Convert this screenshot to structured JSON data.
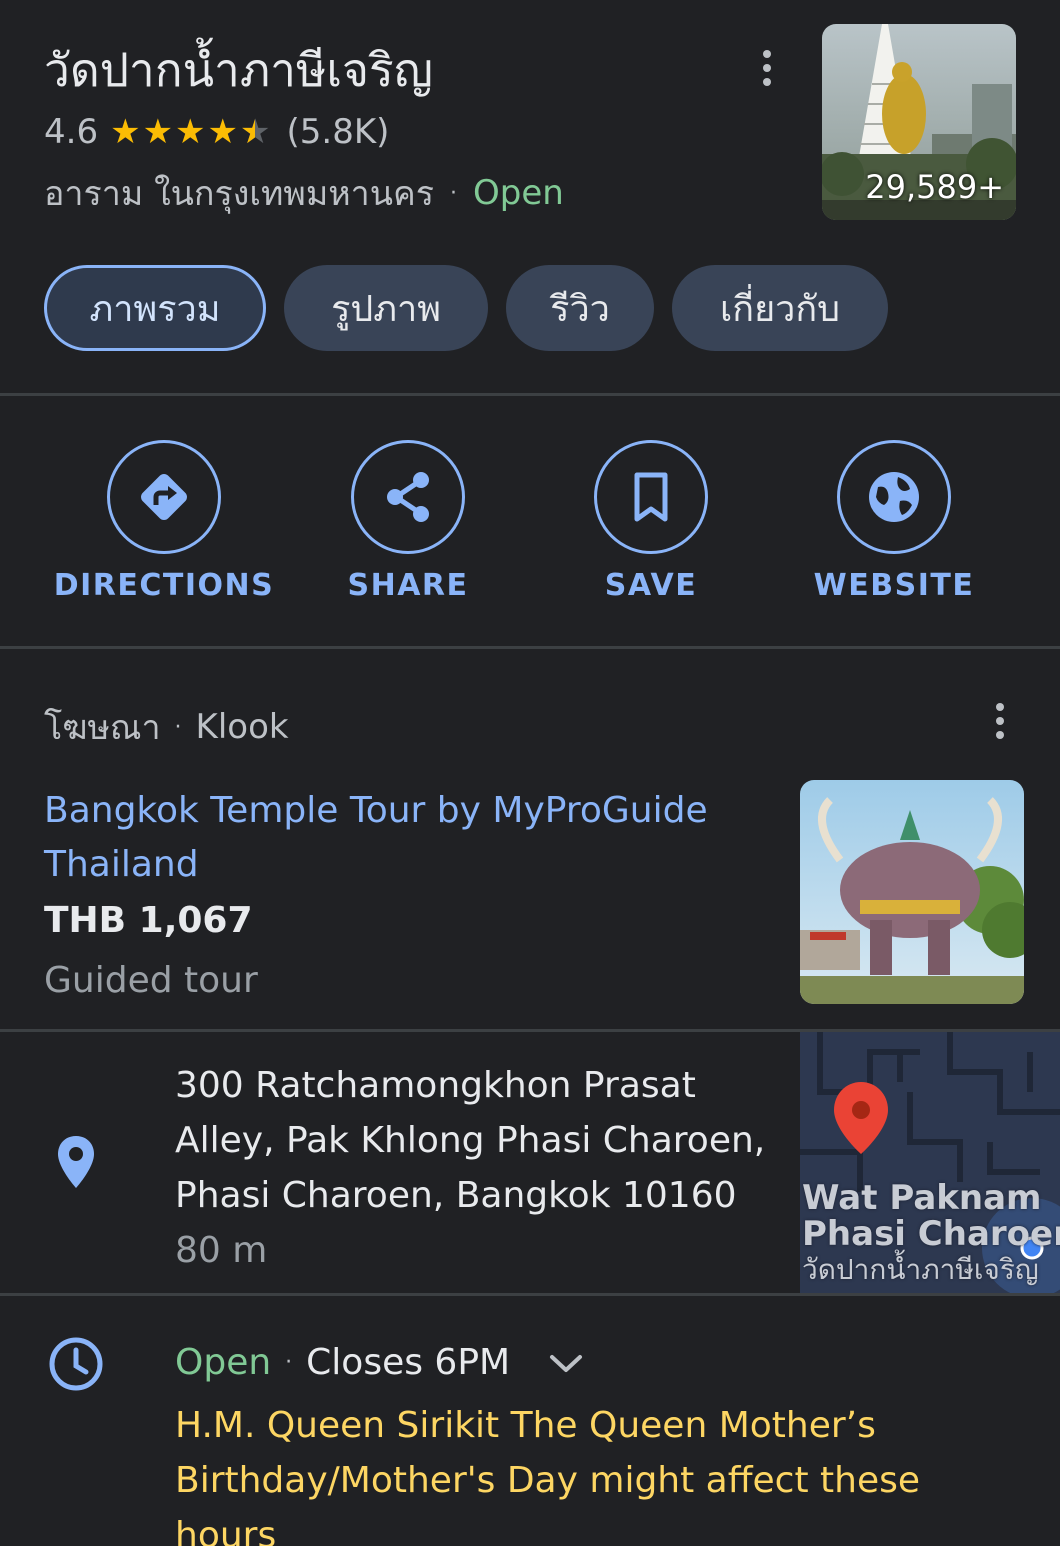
{
  "place": {
    "name": "วัดปากน้ำภาษีเจริญ",
    "rating": "4.6",
    "review_count": "(5.8K)",
    "category": "อาราม ในกรุงเทพมหานคร",
    "status": "Open",
    "photo_count": "29,589+"
  },
  "tabs": [
    {
      "label": "ภาพรวม",
      "active": true
    },
    {
      "label": "รูปภาพ"
    },
    {
      "label": "รีวิว"
    },
    {
      "label": "เกี่ยวกับ"
    }
  ],
  "actions": {
    "directions": "DIRECTIONS",
    "share": "SHARE",
    "save": "SAVE",
    "website": "WEBSITE"
  },
  "ad": {
    "tag": "โฆษณา",
    "provider": "Klook",
    "title": "Bangkok Temple Tour by MyProGuide Thailand",
    "price": "THB 1,067",
    "type": "Guided tour"
  },
  "address": {
    "text": "300 Ratchamongkhon Prasat Alley, Pak Khlong Phasi Charoen, Phasi Charoen, Bangkok 10160",
    "distance": "80 m"
  },
  "map": {
    "label_line1": "Wat Paknam",
    "label_line2": "Phasi Charoen",
    "label_line3": "วัดปากน้ำภาษีเจริญ"
  },
  "hours": {
    "status": "Open",
    "closes": "Closes 6PM",
    "notice": "H.M. Queen Sirikit The Queen Mother’s Birthday/Mother's Day might affect these hours"
  },
  "colors": {
    "background": "#202124",
    "accent_blue": "#8ab4f8",
    "open_green": "#81c995",
    "star_yellow": "#fbbc04",
    "notice_yellow": "#fdd663"
  }
}
